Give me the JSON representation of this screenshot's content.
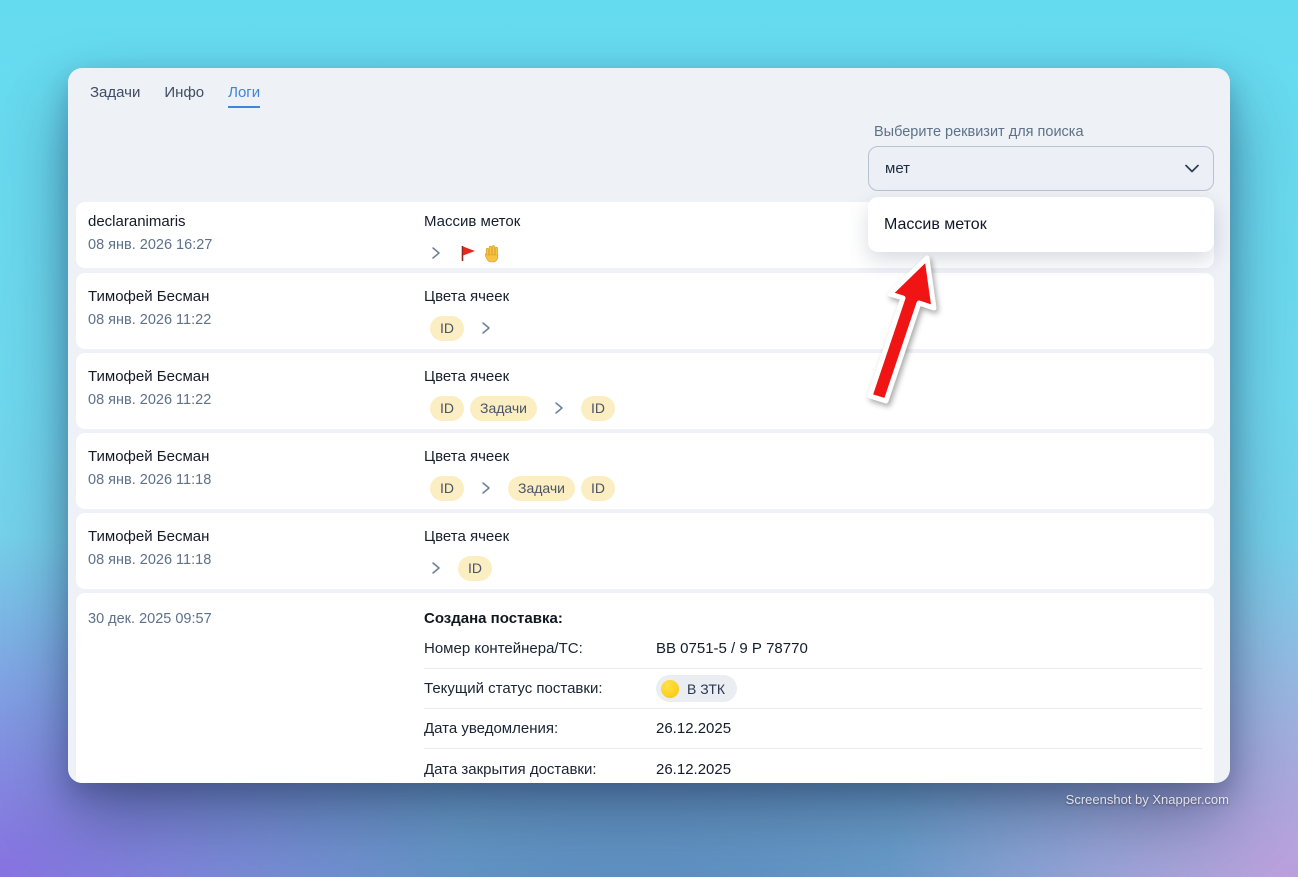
{
  "tabs": {
    "tasks": "Задачи",
    "info": "Инфо",
    "logs": "Логи",
    "active": "Логи"
  },
  "search": {
    "label": "Выберите реквизит для поиска",
    "value": "мет",
    "option": "Массив меток"
  },
  "rows": [
    {
      "author": "declaranimaris",
      "date": "08 янв. 2026 16:27",
      "field": "Массив меток",
      "before": [],
      "after_icons": [
        "red-flag",
        "raised-hand"
      ]
    },
    {
      "author": "Тимофей Бесман",
      "date": "08 янв. 2026 11:22",
      "field": "Цвета ячеек",
      "before": [
        "ID"
      ],
      "after": []
    },
    {
      "author": "Тимофей Бесман",
      "date": "08 янв. 2026 11:22",
      "field": "Цвета ячеек",
      "before": [
        "ID",
        "Задачи"
      ],
      "after": [
        "ID"
      ]
    },
    {
      "author": "Тимофей Бесман",
      "date": "08 янв. 2026 11:18",
      "field": "Цвета ячеек",
      "before": [
        "ID"
      ],
      "after": [
        "Задачи",
        "ID"
      ]
    },
    {
      "author": "Тимофей Бесман",
      "date": "08 янв. 2026 11:18",
      "field": "Цвета ячеек",
      "before": [],
      "after": [
        "ID"
      ]
    }
  ],
  "delivery": {
    "date": "30 дек. 2025 09:57",
    "title": "Создана поставка:",
    "fields": [
      {
        "label": "Номер контейнера/ТС:",
        "value": "ВВ 0751-5 / 9 Р 78770"
      },
      {
        "label": "Текущий статус поставки:",
        "value": "В ЗТК",
        "status_color": "#FFD21E"
      },
      {
        "label": "Дата уведомления:",
        "value": "26.12.2025"
      },
      {
        "label": "Дата закрытия доставки:",
        "value": "26.12.2025"
      }
    ]
  },
  "watermark": "Screenshot by Xnapper.com",
  "colors": {
    "accent_blue": "#3E86D8",
    "pill_yellow": "#FBEEC2",
    "status_yellow": "#FFD21E",
    "arrow_red": "#F01414",
    "panel_bg": "#EEF1F6"
  }
}
